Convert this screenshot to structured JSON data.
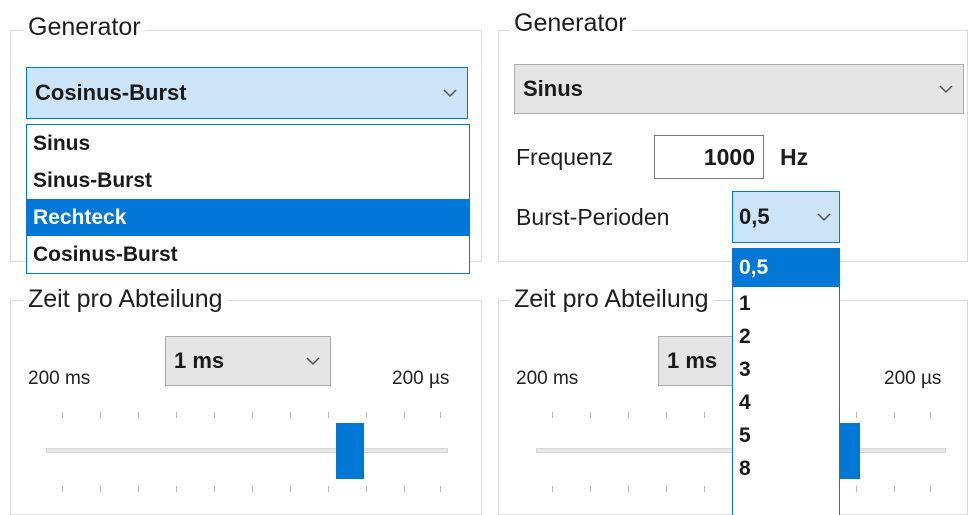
{
  "left": {
    "generator": {
      "title": "Generator",
      "selected": "Cosinus-Burst",
      "options": [
        "Sinus",
        "Sinus-Burst",
        "Rechteck",
        "Cosinus-Burst"
      ],
      "highlighted": "Rechteck"
    },
    "zeit": {
      "title": "Zeit pro Abteilung",
      "min_label": "200 ms",
      "max_label": "200 µs",
      "selected": "1 ms",
      "slider_fraction": 0.78
    }
  },
  "right": {
    "generator": {
      "title": "Generator",
      "selected": "Sinus",
      "frequenz_label": "Frequenz",
      "frequenz_value": "1000",
      "frequenz_unit": "Hz",
      "burst_label": "Burst-Perioden",
      "burst_selected": "0,5",
      "burst_options": [
        "0,5",
        "1",
        "2",
        "3",
        "4",
        "5",
        "8"
      ],
      "burst_highlighted": "0,5"
    },
    "zeit": {
      "title": "Zeit pro Abteilung",
      "min_label": "200 ms",
      "max_label": "200 µs",
      "selected": "1 ms",
      "slider_fraction": 0.78
    }
  },
  "colors": {
    "accent": "#0078d7",
    "focus_bg": "#cce4f7",
    "combo_bg": "#e5e5e5"
  },
  "icons": {
    "combo_arrow": "chevron-down-icon"
  }
}
